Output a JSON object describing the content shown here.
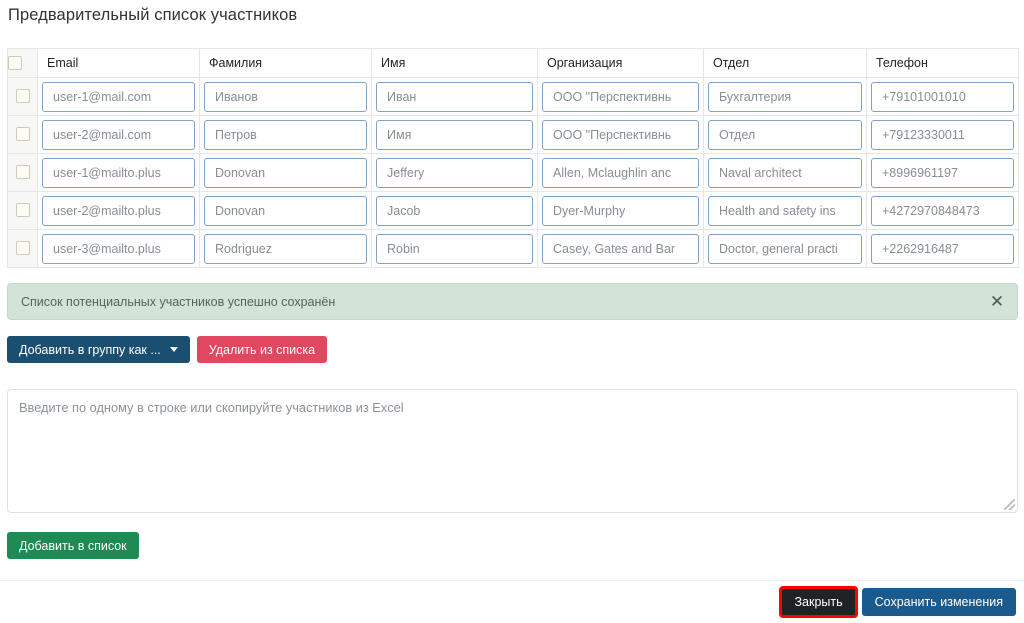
{
  "page": {
    "title": "Предварительный список участников"
  },
  "table": {
    "select_all_checkbox": "unchecked",
    "columns": [
      "Email",
      "Фамилия",
      "Имя",
      "Организация",
      "Отдел",
      "Телефон"
    ],
    "rows": [
      {
        "checked": false,
        "email": "user-1@mail.com",
        "surname": "Иванов",
        "name": "Иван",
        "organization": "ООО \"Перспективнь",
        "department": "Бухгалтерия",
        "phone": "+79101001010"
      },
      {
        "checked": false,
        "email": "user-2@mail.com",
        "surname": "Петров",
        "name": "Имя",
        "organization": "ООО \"Перспективнь",
        "department": "Отдел",
        "phone": "+79123330011"
      },
      {
        "checked": false,
        "email": "user-1@mailto.plus",
        "surname": "Donovan",
        "name": "Jeffery",
        "organization": "Allen, Mclaughlin anc",
        "department": "Naval architect",
        "phone": "+8996961197"
      },
      {
        "checked": false,
        "email": "user-2@mailto.plus",
        "surname": "Donovan",
        "name": "Jacob",
        "organization": "Dyer-Murphy",
        "department": "Health and safety ins",
        "phone": "+4272970848473"
      },
      {
        "checked": false,
        "email": "user-3@mailto.plus",
        "surname": "Rodriguez",
        "name": "Robin",
        "organization": "Casey, Gates and Bar",
        "department": "Doctor, general practi",
        "phone": "+2262916487"
      }
    ]
  },
  "alert": {
    "message": "Список потенциальных участников успешно сохранён",
    "close_icon": "close-x-icon",
    "background_color": "#d3e3d8"
  },
  "actions": {
    "add_to_group_label": "Добавить в группу как ...",
    "add_to_group_color": "#1b4f72",
    "remove_from_list_label": "Удалить из списка",
    "remove_from_list_color": "#e1485f"
  },
  "bulk_input": {
    "placeholder": "Введите по одному в строке или скопируйте участников из Excel",
    "value": "",
    "add_button_label": "Добавить в список",
    "add_button_color": "#1f8a54"
  },
  "footer": {
    "close_label": "Закрыть",
    "close_color": "#1f2326",
    "close_highlight_color": "#ff0000",
    "save_label": "Сохранить изменения",
    "save_color": "#1b5a8c"
  }
}
